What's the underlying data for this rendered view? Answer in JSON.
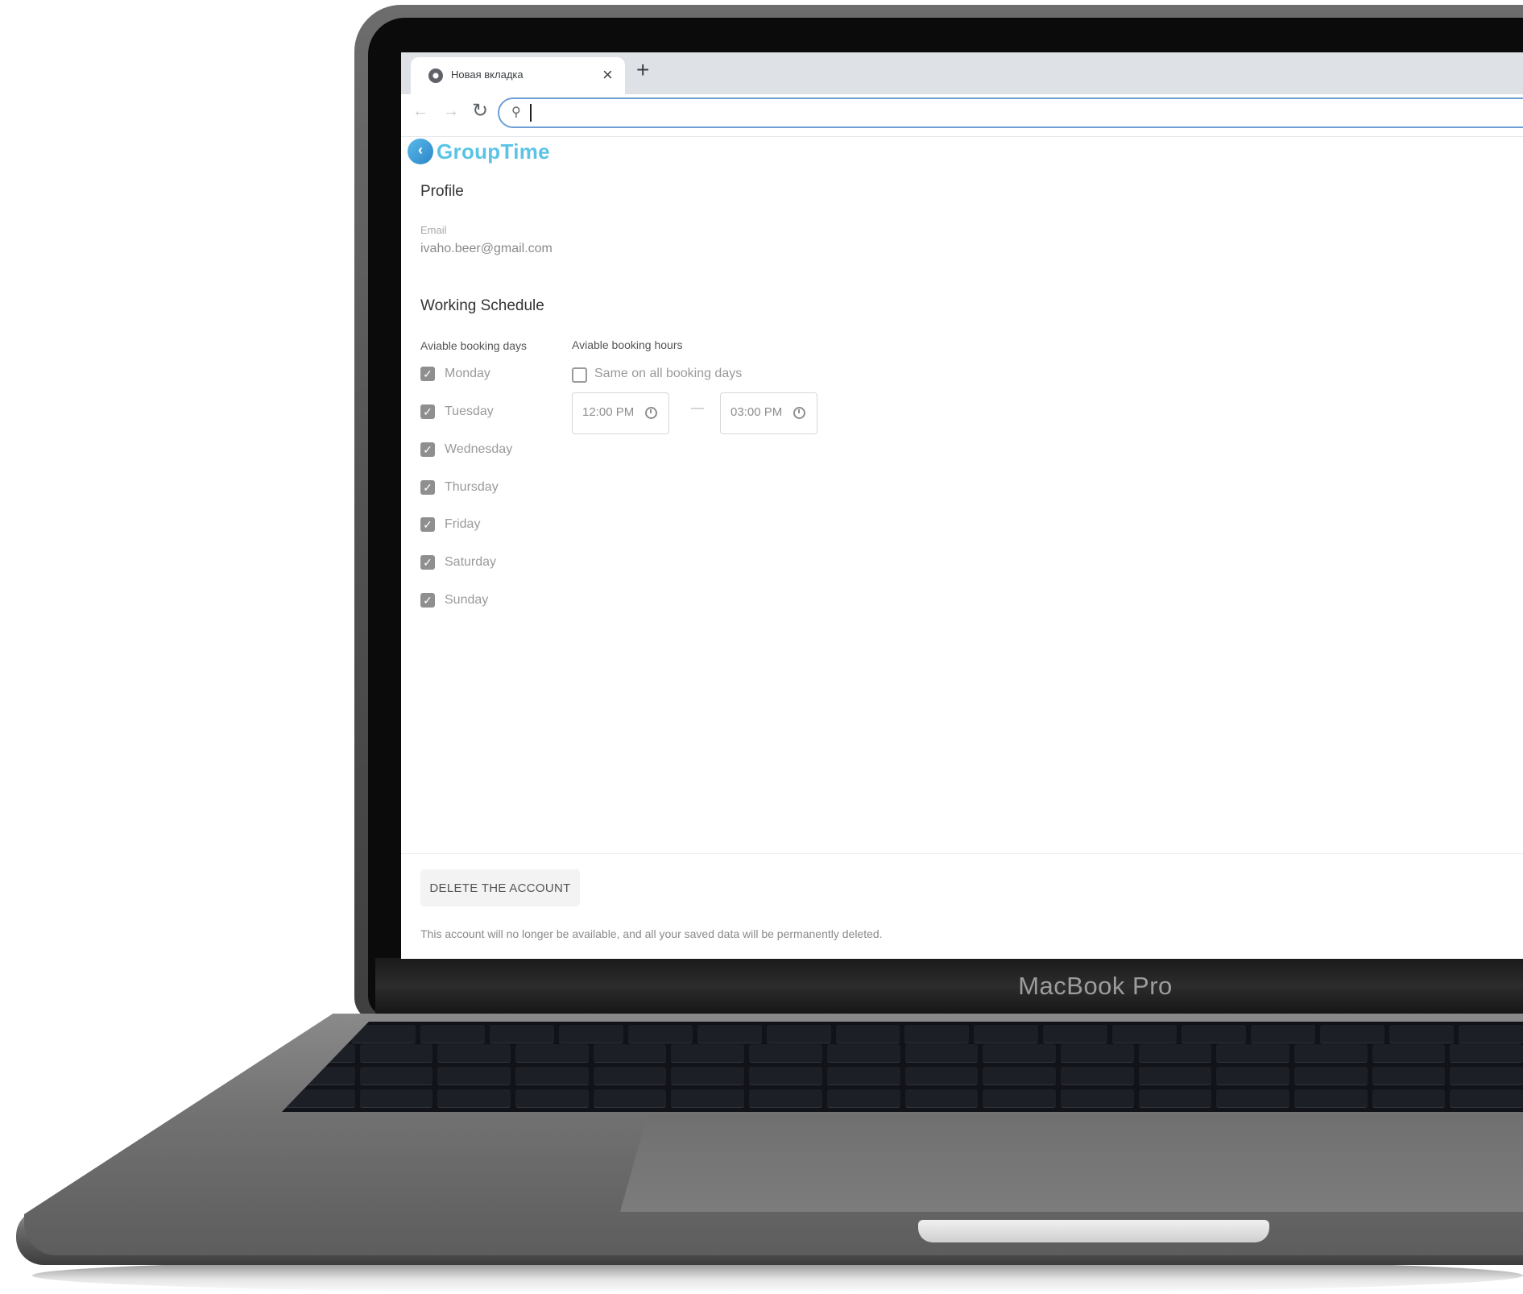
{
  "browser": {
    "tab_title": "Новая вкладка",
    "tab_close_glyph": "×",
    "new_tab_glyph": "+",
    "back_glyph": "←",
    "forward_glyph": "→",
    "reload_glyph": "↻",
    "search_glyph": "⚲",
    "address_value": ""
  },
  "app": {
    "logo_text": "GroupTime",
    "logo_color": "#5bc3e6",
    "profile": {
      "heading": "Profile",
      "email_label": "Email",
      "email_value": "ivaho.beer@gmail.com"
    },
    "schedule": {
      "heading": "Working Schedule",
      "days_heading": "Aviable booking days",
      "hours_heading": "Aviable booking hours",
      "days": [
        {
          "label": "Monday",
          "checked": true
        },
        {
          "label": "Tuesday",
          "checked": true
        },
        {
          "label": "Wednesday",
          "checked": true
        },
        {
          "label": "Thursday",
          "checked": true
        },
        {
          "label": "Friday",
          "checked": true
        },
        {
          "label": "Saturday",
          "checked": true
        },
        {
          "label": "Sunday",
          "checked": true
        }
      ],
      "same_hours_label": "Same on all booking days",
      "same_hours_checked": false,
      "start_time": "12:00 PM",
      "end_time": "03:00 PM",
      "separator": "—"
    },
    "danger": {
      "delete_label": "DELETE THE ACCOUNT",
      "delete_note": "This account will no longer be available, and all your saved data will be permanently deleted."
    }
  },
  "device": {
    "brand_label": "MacBook Pro"
  }
}
